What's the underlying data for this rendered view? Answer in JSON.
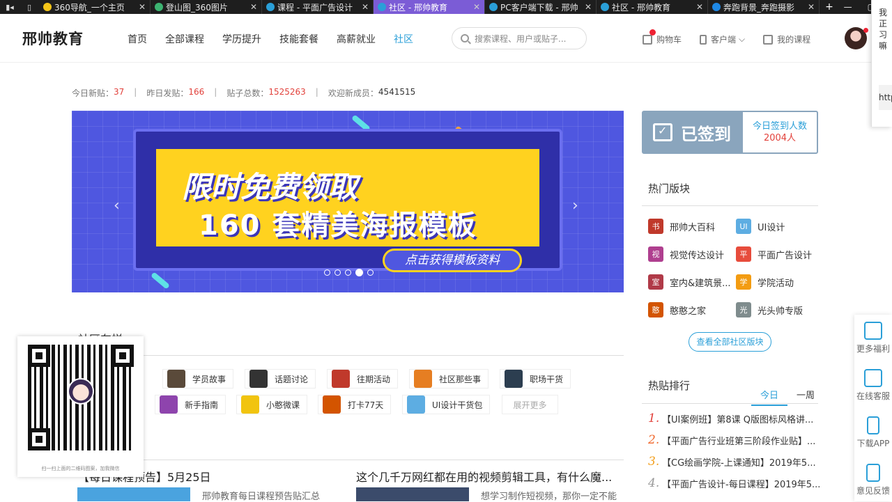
{
  "browser": {
    "tabs": [
      {
        "title": "360导航_一个主页",
        "color": "#f5c518"
      },
      {
        "title": "登山图_360图片",
        "color": "#3cb371"
      },
      {
        "title": "课程 - 平面广告设计",
        "color": "#2a9fd8"
      },
      {
        "title": "社区 - 邢帅教育",
        "color": "#2a9fd8",
        "active": true
      },
      {
        "title": "PC客户端下载 - 邢帅",
        "color": "#2a9fd8"
      },
      {
        "title": "社区 - 邢帅教育",
        "color": "#2a9fd8"
      },
      {
        "title": "奔跑背景_奔跑摄影",
        "color": "#1e88e5"
      }
    ],
    "new_tab": "+"
  },
  "header": {
    "logo": "邢帅教育",
    "nav": [
      "首页",
      "全部课程",
      "学历提升",
      "技能套餐",
      "高薪就业",
      "社区"
    ],
    "active_nav": "社区",
    "search_placeholder": "搜索课程、用户或贴子...",
    "cart": "购物车",
    "client": "客户端",
    "my_courses": "我的课程"
  },
  "edge_popup": {
    "line1": "我正",
    "line2": "习嘛",
    "link": "http"
  },
  "stats": {
    "today_label": "今日新贴：",
    "today": "37",
    "yesterday_label": "昨日发贴：",
    "yesterday": "166",
    "total_label": "贴子总数：",
    "total": "1525263",
    "members_label": "欢迎新成员：",
    "members": "4541515"
  },
  "banner": {
    "line1": "限时免费领取",
    "line2": "160 套精美海报模板",
    "cta": "点击获得模板资料",
    "slide_count": 5,
    "active_slide": 4
  },
  "signin": {
    "status": "已签到",
    "label": "今日签到人数",
    "count": "2004人"
  },
  "hot_sections": {
    "title": "热门版块",
    "items": [
      {
        "label": "邢帅大百科",
        "color": "#c0392b",
        "glyph": "书"
      },
      {
        "label": "UI设计",
        "color": "#5dade2",
        "glyph": "UI"
      },
      {
        "label": "视觉传达设计",
        "color": "#af3f8f",
        "glyph": "视"
      },
      {
        "label": "平面广告设计",
        "color": "#e74c3c",
        "glyph": "平"
      },
      {
        "label": "室内&建筑景...",
        "color": "#b03a48",
        "glyph": "室"
      },
      {
        "label": "学院活动",
        "color": "#f39c12",
        "glyph": "学"
      },
      {
        "label": "憨憨之家",
        "color": "#d35400",
        "glyph": "憨"
      },
      {
        "label": "光头帅专版",
        "color": "#7f8c8d",
        "glyph": "光"
      }
    ],
    "view_all": "查看全部社区版块"
  },
  "hot_posts": {
    "title": "热贴排行",
    "tabs": [
      "今日",
      "一周"
    ],
    "items": [
      {
        "rank": "1.",
        "title": "【UI案例班】第8课 Q版图标风格讲..."
      },
      {
        "rank": "2.",
        "title": "【平面广告行业班第三阶段作业贴】..."
      },
      {
        "rank": "3.",
        "title": "【CG绘画学院-上课通知】2019年5..."
      },
      {
        "rank": "4.",
        "title": "【平面广告设计-每日课程】2019年5..."
      }
    ]
  },
  "community": {
    "title": "社区车样",
    "tags_row1": [
      {
        "label": "学员故事",
        "color": "#5a4a3a"
      },
      {
        "label": "话题讨论",
        "color": "#333"
      },
      {
        "label": "往期活动",
        "color": "#c0392b"
      },
      {
        "label": "社区那些事",
        "color": "#e67e22"
      },
      {
        "label": "职场干货",
        "color": "#2c3e50"
      }
    ],
    "tags_row2": [
      {
        "label": "新手指南",
        "color": "#8e44ad"
      },
      {
        "label": "小憨微课",
        "color": "#f1c40f"
      },
      {
        "label": "打卡77天",
        "color": "#d35400"
      },
      {
        "label": "UI设计干货包",
        "color": "#5dade2"
      }
    ],
    "more": "展开更多"
  },
  "articles": [
    {
      "title": "【每日课程预告】5月25日",
      "desc": "邢帅教育每日课程预告贴汇总",
      "color": "#4aa3df"
    },
    {
      "title": "这个几千万网红都在用的视频剪辑工具，有什么魔...",
      "desc": "想学习制作短视频，那你一定不能",
      "color": "#3b4b6b"
    }
  ],
  "qr": {
    "caption": "扫一扫上面的二维码图案，加我微信"
  },
  "float_bar": [
    "更多福利",
    "在线客服",
    "下载APP",
    "意见反馈"
  ]
}
